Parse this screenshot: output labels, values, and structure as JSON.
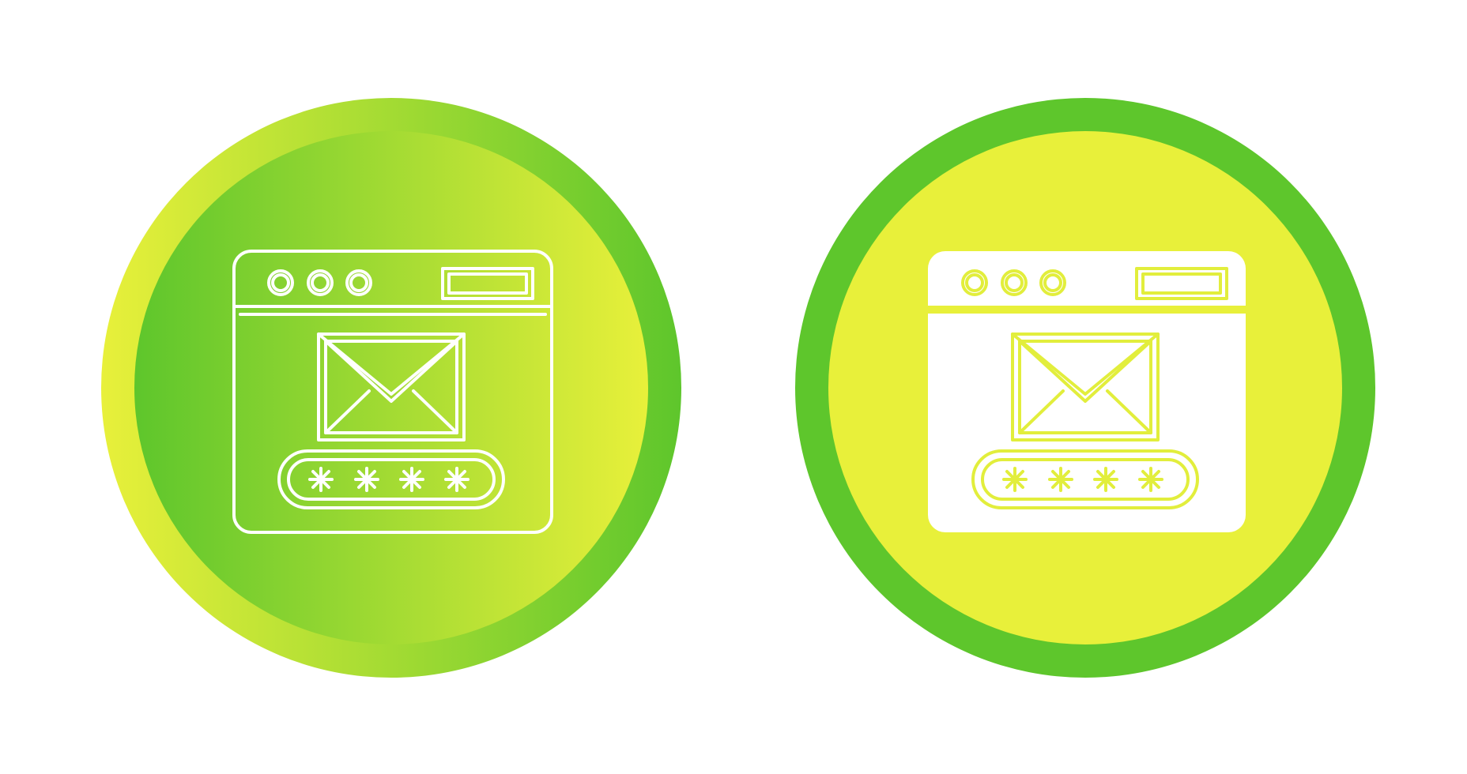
{
  "icons": [
    {
      "name": "email-login-window-icon",
      "style": "line",
      "colors": {
        "outer_ring_gradient": [
          "#e8f03a",
          "#5ec62c"
        ],
        "inner_disc_gradient": [
          "#5ec62c",
          "#e8f03a"
        ],
        "glyph_stroke": "#ffffff"
      },
      "password_mask_count": 4
    },
    {
      "name": "email-login-window-icon",
      "style": "filled",
      "colors": {
        "outer_ring": "#5ec62c",
        "inner_disc": "#e8f03a",
        "glyph_fill": "#ffffff",
        "glyph_stroke": "#e2ee3c"
      },
      "password_mask_count": 4
    }
  ]
}
